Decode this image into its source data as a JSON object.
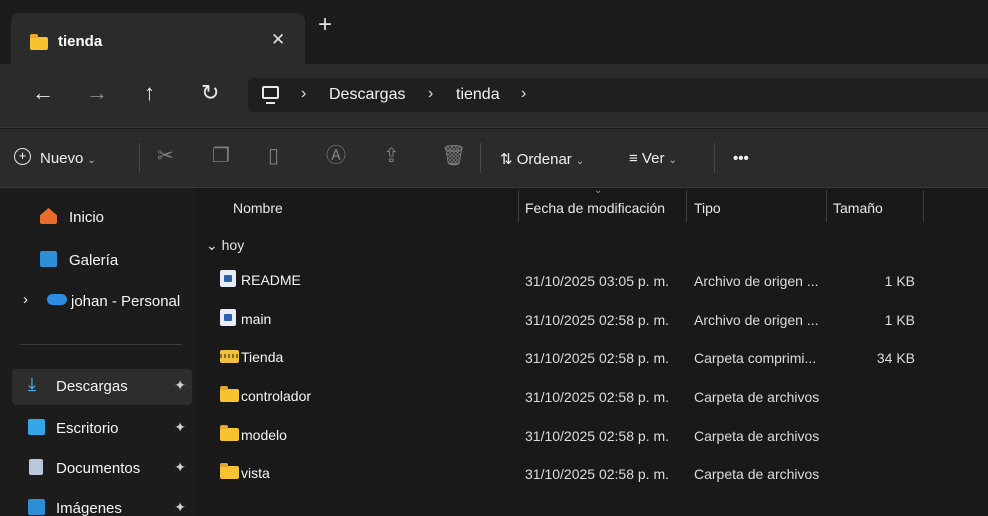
{
  "tab": {
    "title": "tienda",
    "close": "✕",
    "new": "+"
  },
  "nav": {
    "back": "←",
    "forward": "→",
    "up": "↑",
    "refresh": "↻",
    "breadcrumb": [
      "Descargas",
      "tienda"
    ],
    "separator": "›"
  },
  "toolbar": {
    "new_label": "Nuevo",
    "sort_label": "Ordenar",
    "view_label": "Ver",
    "more_label": "•••",
    "caret": "⌄"
  },
  "sidebar": {
    "items": [
      {
        "label": "Inicio",
        "icon": "home-icon"
      },
      {
        "label": "Galería",
        "icon": "gallery-icon"
      },
      {
        "label": "johan - Personal",
        "icon": "onedrive-icon"
      },
      {
        "label": "Descargas",
        "icon": "download-icon"
      },
      {
        "label": "Escritorio",
        "icon": "desktop-icon"
      },
      {
        "label": "Documentos",
        "icon": "documents-icon"
      },
      {
        "label": "Imágenes",
        "icon": "pictures-icon"
      }
    ],
    "expand_glyph": "›",
    "pin_glyph": "📌"
  },
  "list": {
    "columns": {
      "name": "Nombre",
      "date": "Fecha de modificación",
      "type": "Tipo",
      "size": "Tamaño"
    },
    "group": "hoy",
    "rows": [
      {
        "name": "README",
        "date": "31/10/2025 03:05 p. m.",
        "type": "Archivo de origen ...",
        "size": "1 KB",
        "kind": "file"
      },
      {
        "name": "main",
        "date": "31/10/2025 02:58 p. m.",
        "type": "Archivo de origen ...",
        "size": "1 KB",
        "kind": "file"
      },
      {
        "name": "Tienda",
        "date": "31/10/2025 02:58 p. m.",
        "type": "Carpeta comprimi...",
        "size": "34 KB",
        "kind": "zip"
      },
      {
        "name": "controlador",
        "date": "31/10/2025 02:58 p. m.",
        "type": "Carpeta de archivos",
        "size": "",
        "kind": "folder"
      },
      {
        "name": "modelo",
        "date": "31/10/2025 02:58 p. m.",
        "type": "Carpeta de archivos",
        "size": "",
        "kind": "folder"
      },
      {
        "name": "vista",
        "date": "31/10/2025 02:58 p. m.",
        "type": "Carpeta de archivos",
        "size": "",
        "kind": "folder"
      }
    ]
  },
  "colors": {
    "accent": "#4cc2ff",
    "folder": "#f7c331",
    "background": "#191919"
  }
}
